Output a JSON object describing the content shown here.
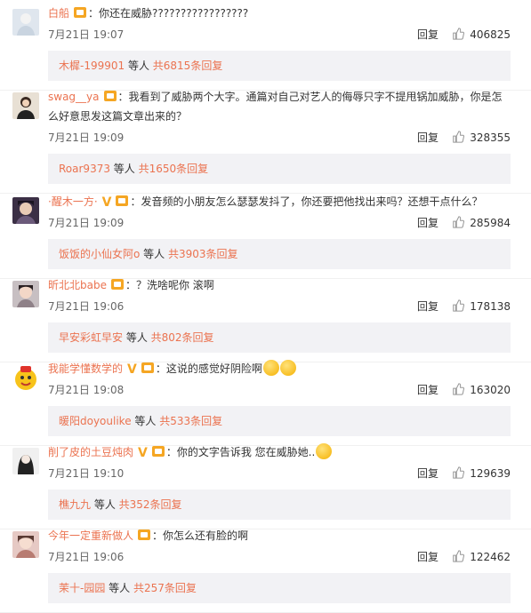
{
  "comments": [
    {
      "username": "白船",
      "badges": [
        "badge"
      ],
      "text": "：你还在威胁?????????????????",
      "date": "7月21日 19:07",
      "reply": "回复",
      "likes": "406825",
      "sub": {
        "name": "木樨-199901",
        "middle": " 等人 ",
        "more": "共6815条回复"
      }
    },
    {
      "username": "swag__ya",
      "badges": [
        "badge"
      ],
      "text": "：我看到了威胁两个大字。通篇对自己对艺人的侮辱只字不提甩锅加威胁，你是怎么好意思发这篇文章出来的？",
      "date": "7月21日 19:09",
      "reply": "回复",
      "likes": "328355",
      "sub": {
        "name": "Roar9373",
        "middle": " 等人 ",
        "more": "共1650条回复"
      }
    },
    {
      "username": "·醒木一方·",
      "badges": [
        "vip",
        "badge"
      ],
      "text": "：发音频的小朋友怎么瑟瑟发抖了，你还要把他找出来吗？还想干点什么？",
      "date": "7月21日 19:09",
      "reply": "回复",
      "likes": "285984",
      "sub": {
        "name": "饭饭的小仙女阿o",
        "middle": " 等人 ",
        "more": "共3903条回复"
      }
    },
    {
      "username": "昕北北babe",
      "badges": [
        "badge"
      ],
      "text": "：？洗啥呢你 滚啊",
      "date": "7月21日 19:06",
      "reply": "回复",
      "likes": "178138",
      "sub": {
        "name": "早安彩虹早安",
        "middle": " 等人 ",
        "more": "共802条回复"
      }
    },
    {
      "username": "我能学懂数学的",
      "badges": [
        "vip",
        "badge"
      ],
      "text": "：这说的感觉好阴险啊",
      "emojis": 2,
      "date": "7月21日 19:08",
      "reply": "回复",
      "likes": "163020",
      "sub": {
        "name": "暖阳doyoulike",
        "middle": " 等人 ",
        "more": "共533条回复"
      }
    },
    {
      "username": "削了皮的土豆炖肉",
      "badges": [
        "vip",
        "badge"
      ],
      "text": "：你的文字告诉我 您在威胁她..",
      "emojis": 1,
      "date": "7月21日 19:10",
      "reply": "回复",
      "likes": "129639",
      "sub": {
        "name": "樵九九",
        "middle": " 等人 ",
        "more": "共352条回复"
      }
    },
    {
      "username": "今年一定重新做人",
      "badges": [
        "badge"
      ],
      "text": "：你怎么还有脸的啊",
      "date": "7月21日 19:06",
      "reply": "回复",
      "likes": "122462",
      "sub": {
        "name": "茉十-园园",
        "middle": " 等人 ",
        "more": "共257条回复"
      }
    }
  ],
  "colors": {
    "accent": "#eb7350",
    "badge": "#f5a623",
    "subbg": "#f2f2f5"
  },
  "icons": {
    "like": "thumbs-up-icon",
    "badge": "member-badge-icon",
    "vip": "v-verified-icon",
    "emoji": "emoji-icon"
  }
}
